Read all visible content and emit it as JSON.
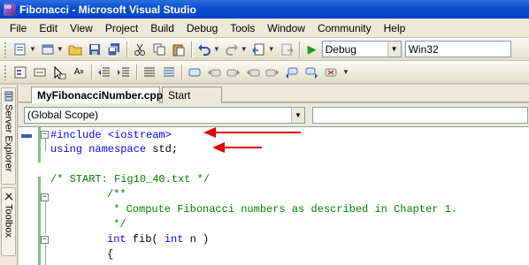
{
  "window": {
    "title": "Fibonacci - Microsoft Visual Studio"
  },
  "menu": [
    "File",
    "Edit",
    "View",
    "Project",
    "Build",
    "Debug",
    "Tools",
    "Window",
    "Community",
    "Help"
  ],
  "toolbar": {
    "configuration": "Debug",
    "platform": "Win32"
  },
  "sidebar": {
    "server_explorer": "Server Explorer",
    "toolbox": "Toolbox"
  },
  "tabs": {
    "file_tab": "MyFibonacciNumber.cpp",
    "start_page": "Start Page"
  },
  "scope": {
    "selected": "(Global Scope)",
    "member": ""
  },
  "code": {
    "l1_a": "#include ",
    "l1_b": "<iostream>",
    "l2_a": "using namespace",
    "l2_b": " std;",
    "l4": "/* START: Fig10_40.txt */",
    "l5": "/**",
    "l6": " * Compute Fibonacci numbers as described in Chapter 1.",
    "l7": " */",
    "l8_a": "int",
    "l8_b": " fib( ",
    "l8_c": "int",
    "l8_d": " n )",
    "l9": "{"
  },
  "colors": {
    "keyword": "#0000ff",
    "comment": "#008000",
    "annotation_arrow": "#e00000",
    "title_bar": "#0a4fd0"
  }
}
